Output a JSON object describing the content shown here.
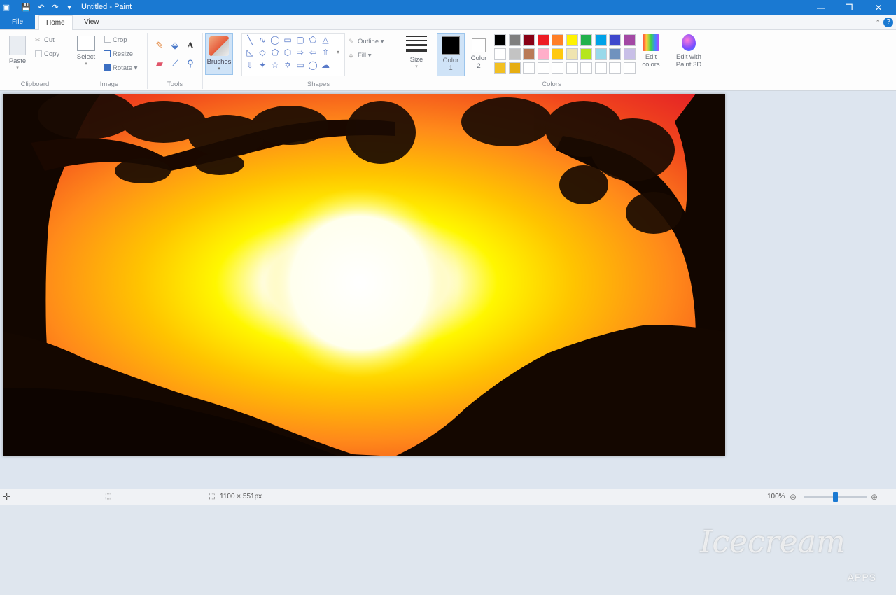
{
  "window": {
    "title": "Untitled - Paint",
    "controls": {
      "minimize": "—",
      "restore": "❐",
      "close": "✕"
    }
  },
  "quick_access": {
    "save": "💾",
    "undo": "↶",
    "redo": "↷",
    "customize": "▾"
  },
  "tabs": {
    "file": "File",
    "home": "Home",
    "view": "View",
    "help": "?"
  },
  "ribbon": {
    "clipboard": {
      "paste": "Paste",
      "cut": "Cut",
      "copy": "Copy",
      "group": "Clipboard"
    },
    "image": {
      "select": "Select",
      "crop": "Crop",
      "resize": "Resize",
      "rotate": "Rotate",
      "group": "Image"
    },
    "tools": {
      "group": "Tools"
    },
    "brushes": {
      "label": "Brushes"
    },
    "shapes": {
      "outline": "Outline",
      "fill": "Fill",
      "group": "Shapes"
    },
    "size": {
      "label": "Size"
    },
    "color1": {
      "label": "Color\n1",
      "value": "#000000"
    },
    "color2": {
      "label": "Color\n2",
      "value": "#ffffff"
    },
    "edit_colors": "Edit colors",
    "edit_paint3d": "Edit with Paint 3D",
    "colors_group": "Colors"
  },
  "palette_row1": [
    "#000000",
    "#7f7f7f",
    "#880015",
    "#ed1c24",
    "#ff7f27",
    "#fff200",
    "#22b14c",
    "#00a2e8",
    "#3f48cc",
    "#a349a4"
  ],
  "palette_row2": [
    "#ffffff",
    "#c3c3c3",
    "#b97a57",
    "#ffaec9",
    "#ffc90e",
    "#efe4b0",
    "#b5e61d",
    "#99d9ea",
    "#7092be",
    "#c8bfe7"
  ],
  "palette_row3": [
    "#f2c022",
    "#e6ad12",
    "#ffffff",
    "#ffffff",
    "#ffffff",
    "#ffffff",
    "#ffffff",
    "#ffffff",
    "#ffffff",
    "#ffffff"
  ],
  "status": {
    "cursor_icon": "crosshair-icon",
    "dimensions": "1100 × 551px",
    "zoom": "100%"
  },
  "watermark": {
    "brand": "Icecream",
    "sub": "APPS"
  }
}
